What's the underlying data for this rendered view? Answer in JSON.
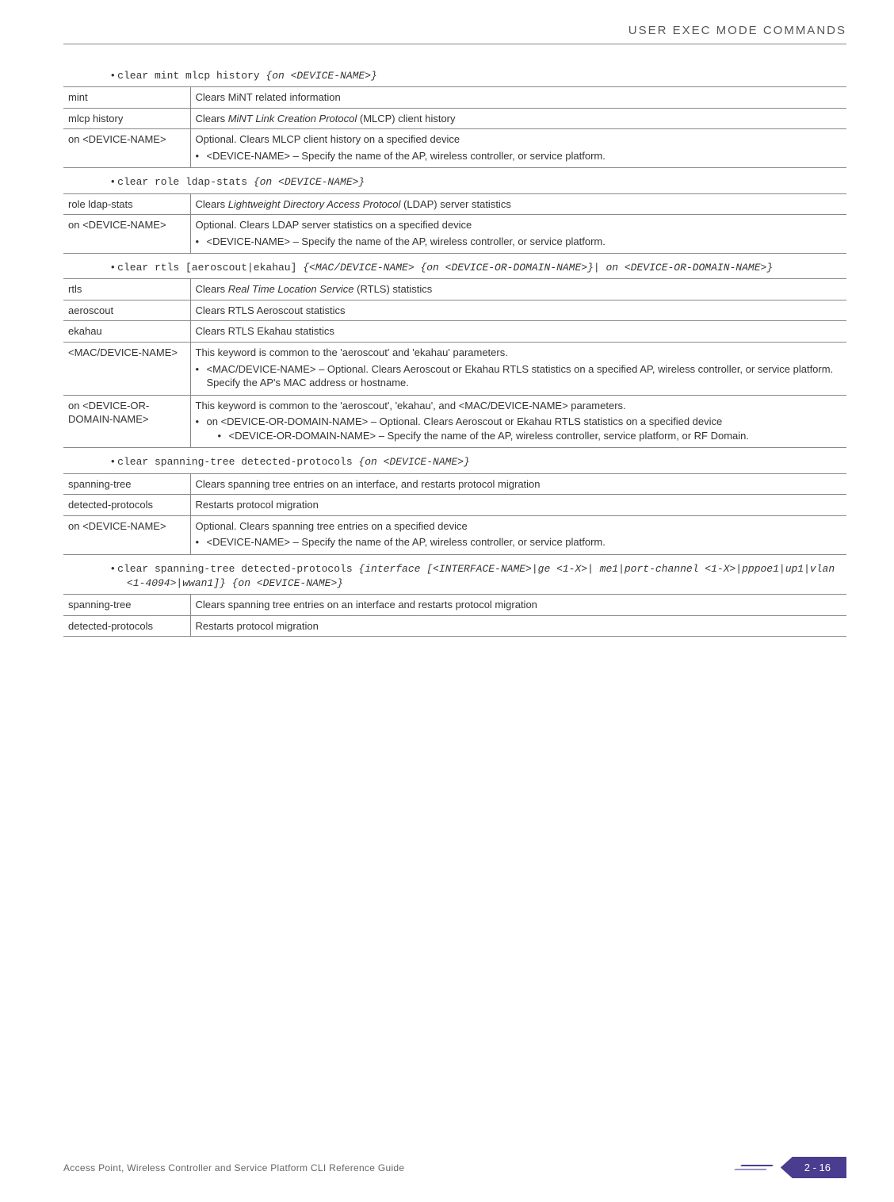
{
  "header": {
    "title": "USER EXEC MODE COMMANDS"
  },
  "sections": [
    {
      "command": {
        "plain": "clear mint mlcp history ",
        "italic": "{on <DEVICE-NAME>}"
      },
      "rows": [
        {
          "k": "mint",
          "v": "Clears MiNT related information"
        },
        {
          "k": "mlcp history",
          "v_html": "Clears <i>MiNT Link Creation Protocol</i> (MLCP) client history"
        },
        {
          "k": "on <DEVICE-NAME>",
          "v": "Optional. Clears MLCP client history on a specified device",
          "bullets": [
            "<DEVICE-NAME> – Specify the name of the AP, wireless controller, or service platform."
          ]
        }
      ]
    },
    {
      "command": {
        "plain": "clear role ldap-stats ",
        "italic": "{on <DEVICE-NAME>}"
      },
      "rows": [
        {
          "k": "role ldap-stats",
          "v_html": "Clears <i>Lightweight Directory Access Protocol</i> (LDAP) server statistics"
        },
        {
          "k": "on <DEVICE-NAME>",
          "v": "Optional. Clears LDAP server statistics on a specified device",
          "bullets": [
            "<DEVICE-NAME> – Specify the name of the AP, wireless controller, or service platform."
          ]
        }
      ]
    },
    {
      "command": {
        "plain": "clear rtls [aeroscout|ekahau] ",
        "italic": "{<MAC/DEVICE-NAME> {on <DEVICE-OR-DOMAIN-NAME>}| on <DEVICE-OR-DOMAIN-NAME>}"
      },
      "rows": [
        {
          "k": "rtls",
          "v_html": "Clears <i>Real Time Location Service</i> (RTLS) statistics"
        },
        {
          "k": "aeroscout",
          "v": "Clears RTLS Aeroscout statistics"
        },
        {
          "k": "ekahau",
          "v": "Clears RTLS Ekahau statistics"
        },
        {
          "k": "<MAC/DEVICE-NAME>",
          "v": "This keyword is common to the 'aeroscout' and 'ekahau' parameters.",
          "bullets": [
            "<MAC/DEVICE-NAME> – Optional. Clears Aeroscout or Ekahau RTLS statistics on a specified AP, wireless controller, or service platform. Specify the AP's MAC address or hostname."
          ]
        },
        {
          "k": "on <DEVICE-OR-DOMAIN-NAME>",
          "v": "This keyword is common to the 'aeroscout', 'ekahau', and <MAC/DEVICE-NAME> parameters.",
          "bullets": [
            "on <DEVICE-OR-DOMAIN-NAME> – Optional. Clears Aeroscout or Ekahau RTLS statistics on a specified device"
          ],
          "nested": [
            "<DEVICE-OR-DOMAIN-NAME> – Specify the name of the AP, wireless controller, service platform, or RF Domain."
          ]
        }
      ]
    },
    {
      "command": {
        "plain": "clear spanning-tree detected-protocols ",
        "italic": "{on <DEVICE-NAME>}"
      },
      "rows": [
        {
          "k": "spanning-tree",
          "v": "Clears spanning tree entries on an interface, and restarts protocol migration"
        },
        {
          "k": "detected-protocols",
          "v": "Restarts protocol migration"
        },
        {
          "k": "on <DEVICE-NAME>",
          "v": "Optional. Clears spanning tree entries on a specified device",
          "bullets": [
            "<DEVICE-NAME> – Specify the name of the AP, wireless controller, or service platform."
          ]
        }
      ]
    },
    {
      "command": {
        "plain": "clear spanning-tree detected-protocols ",
        "italic": "{interface [<INTERFACE-NAME>|ge <1-X>| me1|port-channel <1-X>|pppoe1|up1|vlan <1-4094>|wwan1]} {on <DEVICE-NAME>}"
      },
      "rows": [
        {
          "k": "spanning-tree",
          "v": "Clears spanning tree entries on an interface and restarts protocol migration"
        },
        {
          "k": "detected-protocols",
          "v": "Restarts protocol migration"
        }
      ]
    }
  ],
  "footer": {
    "text": "Access Point, Wireless Controller and Service Platform CLI Reference Guide",
    "page": "2 - 16"
  }
}
